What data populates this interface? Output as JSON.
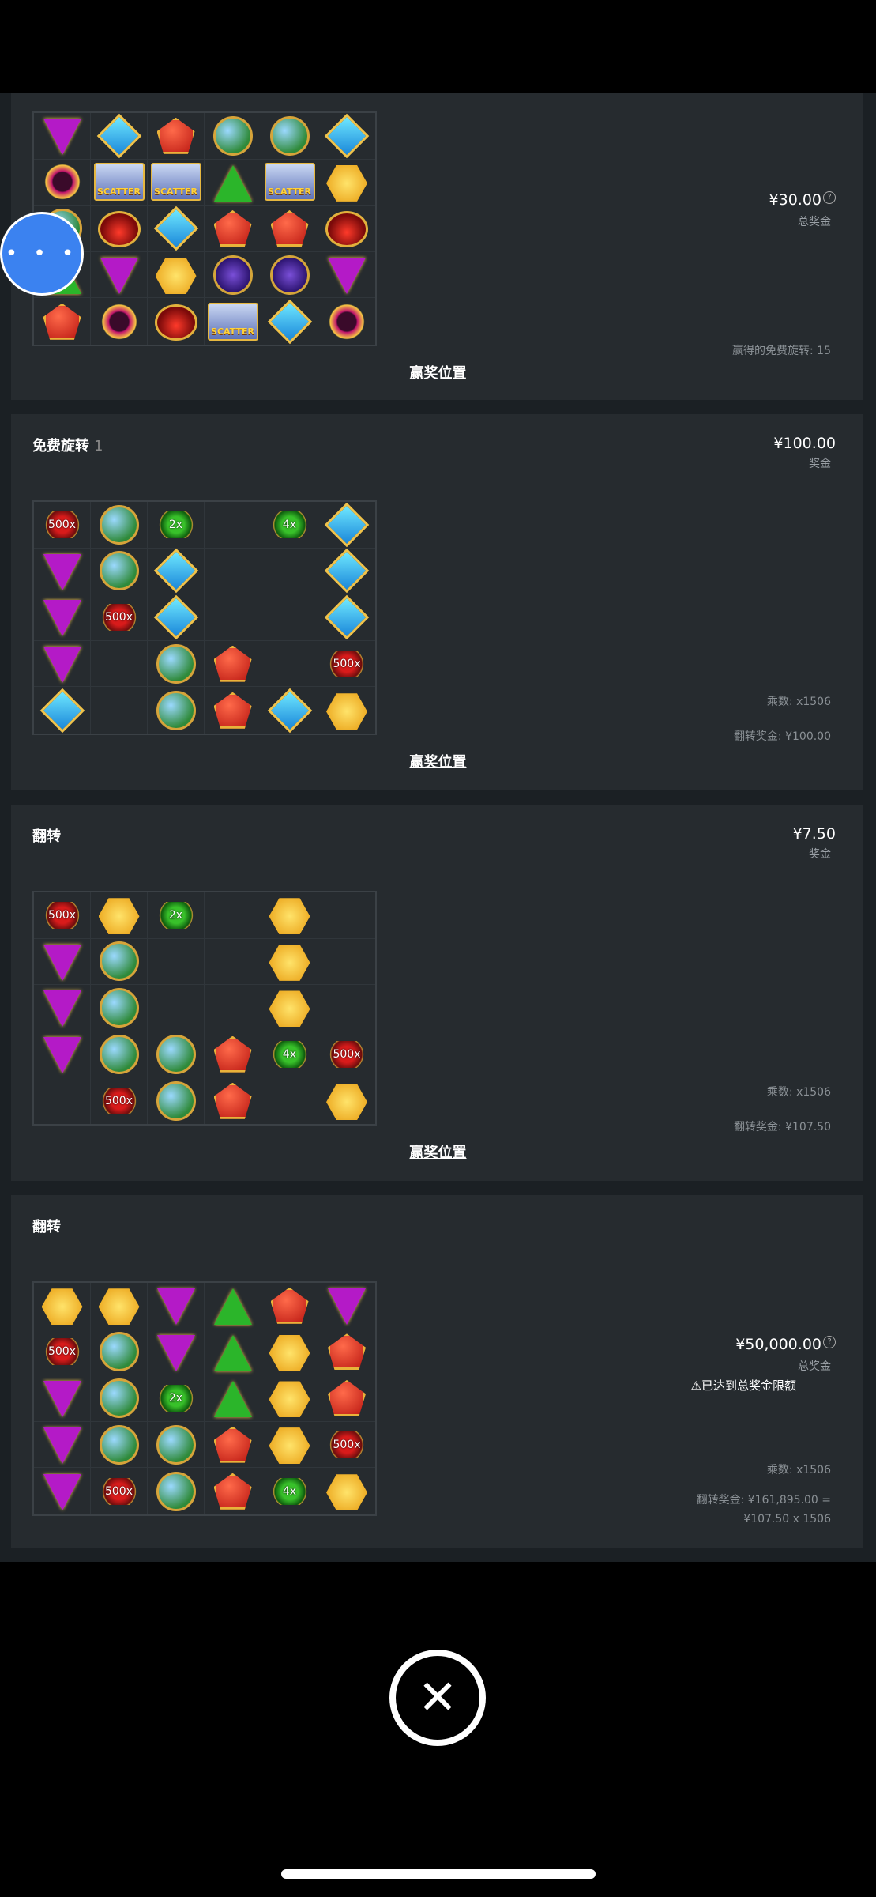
{
  "cards": [
    {
      "title": "",
      "title_num": "",
      "amount": "¥30.00",
      "amount_label": "总奖金",
      "extra": "赢得的免费旋转: 15",
      "link": "赢奖位置",
      "grid": [
        [
          "tri",
          "dia",
          "pent",
          "orb",
          "orb",
          "dia"
        ],
        [
          "ring",
          "scatter",
          "scatter",
          "tri-g",
          "scatter",
          "hex"
        ],
        [
          "orb",
          "crown",
          "dia",
          "pent",
          "pent",
          "crown"
        ],
        [
          "tri-g",
          "tri",
          "hex",
          "purple",
          "purple",
          "tri"
        ],
        [
          "pent",
          "ring",
          "crown",
          "scatter",
          "dia",
          "ring"
        ]
      ]
    },
    {
      "title": "免费旋转",
      "title_num": "1",
      "amount": "¥100.00",
      "amount_label": "奖金",
      "multiplier": "乘数: x1506",
      "spin_win": "翻转奖金: ¥100.00",
      "link": "赢奖位置",
      "grid": [
        [
          "mult:500x",
          "orb",
          "multg:2x",
          "",
          "multg:4x",
          "dia"
        ],
        [
          "tri",
          "orb",
          "dia",
          "",
          "",
          "dia"
        ],
        [
          "tri",
          "mult:500x",
          "dia",
          "",
          "",
          "dia"
        ],
        [
          "tri",
          "",
          "orb",
          "pent",
          "",
          "mult:500x"
        ],
        [
          "dia",
          "",
          "orb",
          "pent",
          "dia",
          "hex"
        ]
      ]
    },
    {
      "title": "翻转",
      "amount": "¥7.50",
      "amount_label": "奖金",
      "multiplier": "乘数: x1506",
      "spin_win": "翻转奖金: ¥107.50",
      "link": "赢奖位置",
      "grid": [
        [
          "mult:500x",
          "hex",
          "multg:2x",
          "",
          "hex",
          ""
        ],
        [
          "tri",
          "orb",
          "",
          "",
          "hex",
          ""
        ],
        [
          "tri",
          "orb",
          "",
          "",
          "hex",
          ""
        ],
        [
          "tri",
          "orb",
          "orb",
          "pent",
          "multg:4x",
          "mult:500x"
        ],
        [
          "",
          "mult:500x",
          "orb",
          "pent",
          "",
          "hex"
        ]
      ]
    },
    {
      "title": "翻转",
      "amount": "¥50,000.00",
      "amount_label": "总奖金",
      "warning": "已达到总奖金限额",
      "multiplier": "乘数: x1506",
      "spin_win_line1": "翻转奖金: ¥161,895.00 =",
      "spin_win_line2": "¥107.50 x 1506",
      "grid": [
        [
          "hex",
          "hex",
          "tri",
          "tri-g",
          "pent",
          "tri"
        ],
        [
          "mult:500x",
          "orb",
          "tri",
          "tri-g",
          "hex",
          "pent"
        ],
        [
          "tri",
          "orb",
          "multg:2x",
          "tri-g",
          "hex",
          "pent"
        ],
        [
          "tri",
          "orb",
          "orb",
          "pent",
          "hex",
          "mult:500x"
        ],
        [
          "tri",
          "mult:500x",
          "orb",
          "pent",
          "multg:4x",
          "hex"
        ]
      ]
    }
  ],
  "scatter_label": "SCATTER",
  "fab_label": "• • •",
  "close_icon": "close-icon"
}
